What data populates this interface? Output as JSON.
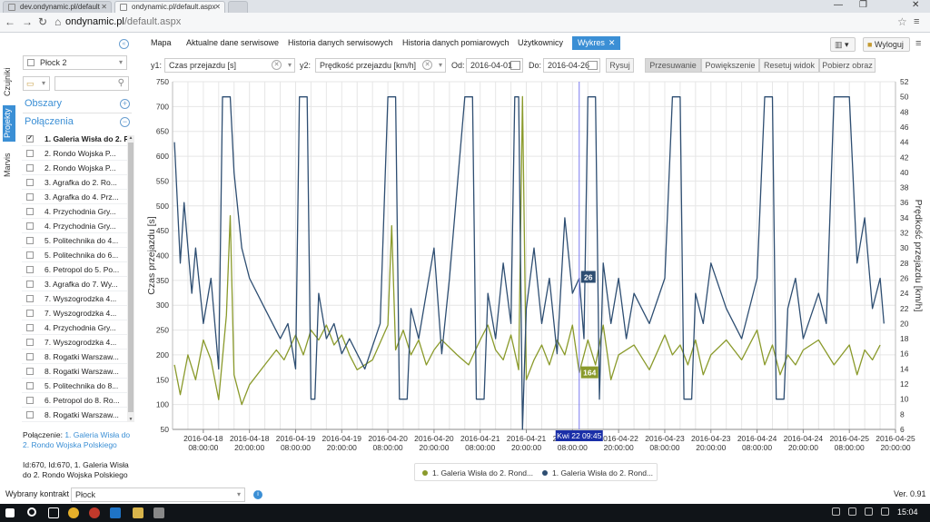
{
  "browser": {
    "tabs": [
      {
        "label": "dev.ondynamic.pl/default"
      },
      {
        "label": "ondynamic.pl/default.aspx"
      }
    ],
    "url_host": "ondynamic.pl",
    "url_path": "/default.aspx"
  },
  "nav": {
    "items": [
      "Mapa",
      "Aktualne dane serwisowe",
      "Historia danych serwisowych",
      "Historia danych pomiarowych",
      "Użytkownicy"
    ],
    "active": "Wykres",
    "logout": "Wyloguj"
  },
  "side_tabs": [
    "Czujniki",
    "Projekty",
    "Marvis"
  ],
  "sidebar": {
    "city_select": "Płock 2",
    "areas_label": "Obszary",
    "connections_label": "Połączenia",
    "connections": [
      "1. Galeria Wisła do 2. Rondo Wojska Polskiego",
      "2. Rondo Wojska P...",
      "2. Rondo Wojska P...",
      "3. Agrafka do 2. Ro...",
      "3. Agrafka do 4. Prz...",
      "4. Przychodnia Gry...",
      "4. Przychodnia Gry...",
      "5. Politechnika do 4...",
      "5. Politechnika do 6...",
      "6. Petropol do 5. Po...",
      "3. Agrafka do 7. Wy...",
      "7. Wyszogrodzka 4...",
      "7. Wyszogrodzka 4...",
      "4. Przychodnia Gry...",
      "7. Wyszogrodzka 4...",
      "8. Rogatki Warszaw...",
      "8. Rogatki Warszaw...",
      "5. Politechnika do 8...",
      "6. Petropol do 8. Ro...",
      "8. Rogatki Warszaw..."
    ],
    "conn_info_label": "Połączenie:",
    "conn_info_link": "1. Galeria Wisła do 2. Rondo Wojska Polskiego",
    "id_info": "Id:670, Id:670, 1. Galeria Wisła do 2. Rondo Wojska Polskiego"
  },
  "controls": {
    "y1_label": "y1:",
    "y1_value": "Czas przejazdu [s]",
    "y2_label": "y2:",
    "y2_value": "Prędkość przejazdu [km/h]",
    "from_label": "Od:",
    "from_value": "2016-04-01",
    "to_label": "Do:",
    "to_value": "2016-04-26",
    "draw_btn": "Rysuj",
    "pan_btn": "Przesuwanie",
    "zoom_btn": "Powiększenie",
    "reset_btn": "Resetuj widok",
    "download_btn": "Pobierz obraz"
  },
  "footer": {
    "contract_label": "Wybrany kontrakt",
    "contract_value": "Płock",
    "version": "Ver. 0.91",
    "clock": "15:04"
  },
  "colors": {
    "accent": "#3b8fd5",
    "series_speed": "#8a9a2b",
    "series_time": "#2e4e72",
    "crosshair": "#7a7af0"
  },
  "chart_data": {
    "type": "line",
    "ylabel": "Czas przejazdu [s]",
    "y2label": "Prędkość przejazdu [km/h]",
    "ylim": [
      50,
      750
    ],
    "y2lim": [
      6,
      52
    ],
    "xlim": [
      "2016-04-18 00:00",
      "2016-04-25 20:00"
    ],
    "x_ticks": [
      [
        "2016-04-18",
        "08:00:00"
      ],
      [
        "2016-04-18",
        "20:00:00"
      ],
      [
        "2016-04-19",
        "08:00:00"
      ],
      [
        "2016-04-19",
        "20:00:00"
      ],
      [
        "2016-04-20",
        "08:00:00"
      ],
      [
        "2016-04-20",
        "20:00:00"
      ],
      [
        "2016-04-21",
        "08:00:00"
      ],
      [
        "2016-04-21",
        "20:00:00"
      ],
      [
        "2016-04-22",
        "08:00:00"
      ],
      [
        "2016-04-22",
        "20:00:00"
      ],
      [
        "2016-04-23",
        "08:00:00"
      ],
      [
        "2016-04-23",
        "20:00:00"
      ],
      [
        "2016-04-24",
        "08:00:00"
      ],
      [
        "2016-04-24",
        "20:00:00"
      ],
      [
        "2016-04-25",
        "08:00:00"
      ],
      [
        "2016-04-25",
        "20:00:00"
      ]
    ],
    "y_ticks": [
      50,
      100,
      150,
      200,
      250,
      300,
      350,
      400,
      450,
      500,
      550,
      600,
      650,
      700,
      750
    ],
    "y2_ticks": [
      6,
      8,
      10,
      12,
      14,
      16,
      18,
      20,
      22,
      24,
      26,
      28,
      30,
      32,
      34,
      36,
      38,
      40,
      42,
      44,
      46,
      48,
      50,
      52
    ],
    "grid": true,
    "legend_position": "bottom",
    "crosshair_label": "Kwi 22 09:45",
    "tooltip_speed": "26",
    "tooltip_time": "164",
    "series": [
      {
        "name": "1. Galeria Wisła do 2. Rond...",
        "axis": "y1",
        "color": "#8a9a2b",
        "points": [
          [
            "2016-04-18 00:30",
            180
          ],
          [
            "2016-04-18 02:00",
            120
          ],
          [
            "2016-04-18 04:00",
            200
          ],
          [
            "2016-04-18 06:00",
            150
          ],
          [
            "2016-04-18 08:00",
            230
          ],
          [
            "2016-04-18 10:00",
            190
          ],
          [
            "2016-04-18 12:00",
            110
          ],
          [
            "2016-04-18 14:00",
            280
          ],
          [
            "2016-04-18 15:00",
            480
          ],
          [
            "2016-04-18 16:00",
            160
          ],
          [
            "2016-04-18 18:00",
            100
          ],
          [
            "2016-04-18 20:00",
            140
          ],
          [
            "2016-04-19 00:00",
            180
          ],
          [
            "2016-04-19 03:00",
            210
          ],
          [
            "2016-04-19 05:00",
            190
          ],
          [
            "2016-04-19 08:00",
            240
          ],
          [
            "2016-04-19 10:00",
            200
          ],
          [
            "2016-04-19 12:00",
            250
          ],
          [
            "2016-04-19 14:00",
            230
          ],
          [
            "2016-04-19 16:00",
            260
          ],
          [
            "2016-04-19 18:00",
            220
          ],
          [
            "2016-04-19 20:00",
            240
          ],
          [
            "2016-04-19 22:00",
            200
          ],
          [
            "2016-04-20 00:00",
            170
          ],
          [
            "2016-04-20 04:00",
            190
          ],
          [
            "2016-04-20 08:00",
            260
          ],
          [
            "2016-04-20 09:00",
            460
          ],
          [
            "2016-04-20 10:00",
            210
          ],
          [
            "2016-04-20 12:00",
            250
          ],
          [
            "2016-04-20 14:00",
            200
          ],
          [
            "2016-04-20 16:00",
            230
          ],
          [
            "2016-04-20 18:00",
            180
          ],
          [
            "2016-04-20 20:00",
            210
          ],
          [
            "2016-04-20 22:00",
            230
          ],
          [
            "2016-04-21 02:00",
            200
          ],
          [
            "2016-04-21 05:00",
            180
          ],
          [
            "2016-04-21 08:00",
            230
          ],
          [
            "2016-04-21 10:00",
            260
          ],
          [
            "2016-04-21 12:00",
            210
          ],
          [
            "2016-04-21 14:00",
            190
          ],
          [
            "2016-04-21 16:00",
            240
          ],
          [
            "2016-04-21 18:00",
            170
          ],
          [
            "2016-04-21 19:00",
            720
          ],
          [
            "2016-04-21 20:00",
            150
          ],
          [
            "2016-04-21 22:00",
            190
          ],
          [
            "2016-04-22 00:00",
            220
          ],
          [
            "2016-04-22 02:00",
            180
          ],
          [
            "2016-04-22 04:00",
            230
          ],
          [
            "2016-04-22 06:00",
            200
          ],
          [
            "2016-04-22 08:00",
            260
          ],
          [
            "2016-04-22 09:45",
            164
          ],
          [
            "2016-04-22 12:00",
            230
          ],
          [
            "2016-04-22 14:00",
            180
          ],
          [
            "2016-04-22 16:00",
            260
          ],
          [
            "2016-04-22 18:00",
            150
          ],
          [
            "2016-04-22 20:00",
            200
          ],
          [
            "2016-04-23 00:00",
            220
          ],
          [
            "2016-04-23 04:00",
            170
          ],
          [
            "2016-04-23 08:00",
            240
          ],
          [
            "2016-04-23 10:00",
            200
          ],
          [
            "2016-04-23 12:00",
            220
          ],
          [
            "2016-04-23 14:00",
            180
          ],
          [
            "2016-04-23 16:00",
            230
          ],
          [
            "2016-04-23 18:00",
            160
          ],
          [
            "2016-04-23 20:00",
            200
          ],
          [
            "2016-04-24 00:00",
            230
          ],
          [
            "2016-04-24 04:00",
            190
          ],
          [
            "2016-04-24 08:00",
            250
          ],
          [
            "2016-04-24 10:00",
            180
          ],
          [
            "2016-04-24 12:00",
            220
          ],
          [
            "2016-04-24 14:00",
            160
          ],
          [
            "2016-04-24 16:00",
            200
          ],
          [
            "2016-04-24 18:00",
            180
          ],
          [
            "2016-04-24 20:00",
            210
          ],
          [
            "2016-04-25 00:00",
            230
          ],
          [
            "2016-04-25 04:00",
            180
          ],
          [
            "2016-04-25 08:00",
            220
          ],
          [
            "2016-04-25 10:00",
            160
          ],
          [
            "2016-04-25 12:00",
            210
          ],
          [
            "2016-04-25 14:00",
            190
          ],
          [
            "2016-04-25 16:00",
            220
          ]
        ]
      },
      {
        "name": "1. Galeria Wisła do 2. Rond...",
        "axis": "y2",
        "color": "#2e4e72",
        "points": [
          [
            "2016-04-18 00:30",
            44
          ],
          [
            "2016-04-18 02:00",
            28
          ],
          [
            "2016-04-18 03:00",
            36
          ],
          [
            "2016-04-18 05:00",
            24
          ],
          [
            "2016-04-18 06:00",
            30
          ],
          [
            "2016-04-18 08:00",
            20
          ],
          [
            "2016-04-18 10:00",
            26
          ],
          [
            "2016-04-18 12:00",
            14
          ],
          [
            "2016-04-18 13:00",
            50
          ],
          [
            "2016-04-18 15:00",
            50
          ],
          [
            "2016-04-18 16:00",
            40
          ],
          [
            "2016-04-18 18:00",
            30
          ],
          [
            "2016-04-18 20:00",
            26
          ],
          [
            "2016-04-19 00:00",
            22
          ],
          [
            "2016-04-19 04:00",
            18
          ],
          [
            "2016-04-19 06:00",
            20
          ],
          [
            "2016-04-19 08:00",
            14
          ],
          [
            "2016-04-19 09:00",
            50
          ],
          [
            "2016-04-19 11:00",
            50
          ],
          [
            "2016-04-19 12:00",
            10
          ],
          [
            "2016-04-19 13:00",
            10
          ],
          [
            "2016-04-19 14:00",
            24
          ],
          [
            "2016-04-19 16:00",
            18
          ],
          [
            "2016-04-19 18:00",
            20
          ],
          [
            "2016-04-19 20:00",
            16
          ],
          [
            "2016-04-19 22:00",
            18
          ],
          [
            "2016-04-20 02:00",
            14
          ],
          [
            "2016-04-20 06:00",
            20
          ],
          [
            "2016-04-20 08:00",
            50
          ],
          [
            "2016-04-20 10:00",
            50
          ],
          [
            "2016-04-20 11:00",
            10
          ],
          [
            "2016-04-20 13:00",
            10
          ],
          [
            "2016-04-20 14:00",
            22
          ],
          [
            "2016-04-20 16:00",
            18
          ],
          [
            "2016-04-20 18:00",
            24
          ],
          [
            "2016-04-20 20:00",
            30
          ],
          [
            "2016-04-20 22:00",
            16
          ],
          [
            "2016-04-21 00:00",
            26
          ],
          [
            "2016-04-21 04:00",
            50
          ],
          [
            "2016-04-21 06:00",
            50
          ],
          [
            "2016-04-21 07:00",
            10
          ],
          [
            "2016-04-21 09:00",
            10
          ],
          [
            "2016-04-21 10:00",
            24
          ],
          [
            "2016-04-21 12:00",
            18
          ],
          [
            "2016-04-21 14:00",
            28
          ],
          [
            "2016-04-21 16:00",
            20
          ],
          [
            "2016-04-21 17:00",
            50
          ],
          [
            "2016-04-21 18:00",
            50
          ],
          [
            "2016-04-21 19:00",
            6
          ],
          [
            "2016-04-21 20:00",
            22
          ],
          [
            "2016-04-21 22:00",
            30
          ],
          [
            "2016-04-22 00:00",
            20
          ],
          [
            "2016-04-22 02:00",
            26
          ],
          [
            "2016-04-22 04:00",
            16
          ],
          [
            "2016-04-22 06:00",
            34
          ],
          [
            "2016-04-22 08:00",
            24
          ],
          [
            "2016-04-22 09:45",
            26
          ],
          [
            "2016-04-22 11:00",
            18
          ],
          [
            "2016-04-22 12:00",
            50
          ],
          [
            "2016-04-22 14:00",
            50
          ],
          [
            "2016-04-22 15:00",
            10
          ],
          [
            "2016-04-22 16:00",
            28
          ],
          [
            "2016-04-22 18:00",
            20
          ],
          [
            "2016-04-22 20:00",
            26
          ],
          [
            "2016-04-22 22:00",
            18
          ],
          [
            "2016-04-23 00:00",
            24
          ],
          [
            "2016-04-23 04:00",
            20
          ],
          [
            "2016-04-23 08:00",
            26
          ],
          [
            "2016-04-23 10:00",
            50
          ],
          [
            "2016-04-23 12:00",
            50
          ],
          [
            "2016-04-23 13:00",
            10
          ],
          [
            "2016-04-23 15:00",
            10
          ],
          [
            "2016-04-23 16:00",
            24
          ],
          [
            "2016-04-23 18:00",
            20
          ],
          [
            "2016-04-23 20:00",
            28
          ],
          [
            "2016-04-24 00:00",
            22
          ],
          [
            "2016-04-24 04:00",
            18
          ],
          [
            "2016-04-24 08:00",
            26
          ],
          [
            "2016-04-24 10:00",
            50
          ],
          [
            "2016-04-24 12:00",
            50
          ],
          [
            "2016-04-24 13:00",
            10
          ],
          [
            "2016-04-24 15:00",
            10
          ],
          [
            "2016-04-24 16:00",
            22
          ],
          [
            "2016-04-24 18:00",
            26
          ],
          [
            "2016-04-24 20:00",
            18
          ],
          [
            "2016-04-25 00:00",
            24
          ],
          [
            "2016-04-25 02:00",
            20
          ],
          [
            "2016-04-25 04:00",
            50
          ],
          [
            "2016-04-25 08:00",
            50
          ],
          [
            "2016-04-25 10:00",
            28
          ],
          [
            "2016-04-25 12:00",
            34
          ],
          [
            "2016-04-25 14:00",
            22
          ],
          [
            "2016-04-25 16:00",
            26
          ],
          [
            "2016-04-25 17:00",
            20
          ]
        ]
      }
    ]
  }
}
